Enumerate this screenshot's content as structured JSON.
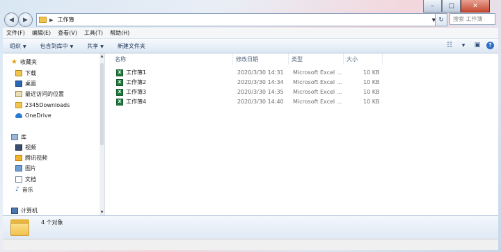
{
  "address": {
    "path": "工作簿",
    "search_placeholder": "搜索 工作簿"
  },
  "menu": [
    "文件(F)",
    "编辑(E)",
    "查看(V)",
    "工具(T)",
    "帮助(H)"
  ],
  "toolbar": {
    "organize": "组织",
    "include_library": "包含到库中",
    "share": "共享",
    "new_folder": "新建文件夹"
  },
  "nav": {
    "favorites_label": "收藏夹",
    "favorites": [
      "下载",
      "桌面",
      "最近访问的位置",
      "2345Downloads",
      "OneDrive"
    ],
    "libraries_label": "库",
    "libraries": [
      "视频",
      "腾讯视频",
      "图片",
      "文档",
      "音乐"
    ],
    "computer_label": "计算机"
  },
  "columns": {
    "name": "名称",
    "modified": "修改日期",
    "type": "类型",
    "size": "大小"
  },
  "files": [
    {
      "name": "工作簿1",
      "modified": "2020/3/30 14:31",
      "type": "Microsoft Excel ...",
      "size": "10 KB"
    },
    {
      "name": "工作簿2",
      "modified": "2020/3/30 14:34",
      "type": "Microsoft Excel ...",
      "size": "10 KB"
    },
    {
      "name": "工作簿3",
      "modified": "2020/3/30 14:35",
      "type": "Microsoft Excel ...",
      "size": "10 KB"
    },
    {
      "name": "工作簿4",
      "modified": "2020/3/30 14:40",
      "type": "Microsoft Excel ...",
      "size": "10 KB"
    }
  ],
  "details": {
    "count": "4 个对象"
  },
  "icons": {
    "file_icon": "excel-icon",
    "folder_icon": "folder-icon"
  }
}
